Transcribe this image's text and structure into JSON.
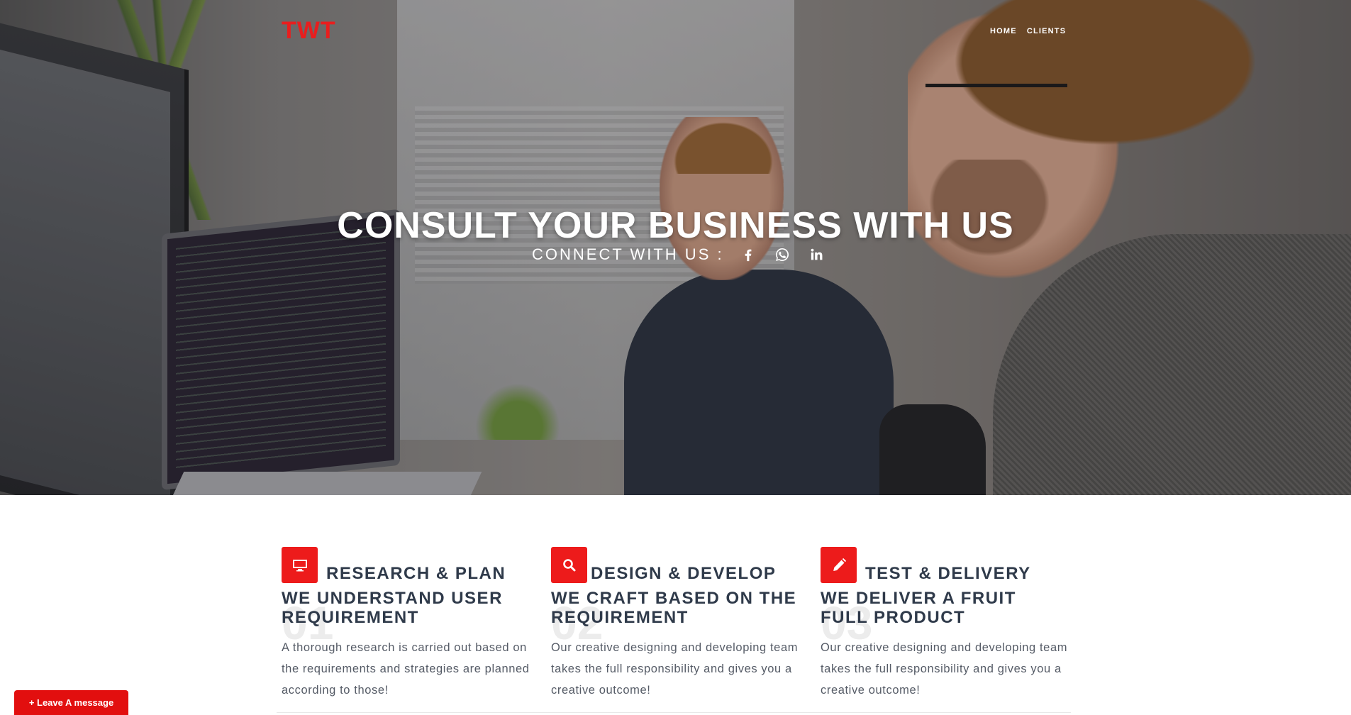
{
  "header": {
    "logo": "TWT",
    "nav": [
      {
        "label": "HOME"
      },
      {
        "label": "CLIENTS"
      }
    ]
  },
  "hero": {
    "title": "CONSULT YOUR BUSINESS WITH US",
    "connect_label": "CONNECT WITH US :",
    "social_icons": [
      "facebook-icon",
      "whatsapp-icon",
      "linkedin-icon"
    ]
  },
  "features": [
    {
      "icon": "desktop-icon",
      "number": "01",
      "title": "RESEARCH & PLAN",
      "subtitle": "WE UNDERSTAND USER REQUIREMENT",
      "description": "A thorough research is carried out based on the requirements and strategies are planned according to those!"
    },
    {
      "icon": "search-icon",
      "number": "02",
      "title": "DESIGN & DEVELOP",
      "subtitle": "WE CRAFT BASED ON THE REQUIREMENT",
      "description": "Our creative designing and developing team takes the full responsibility and gives you a creative outcome!"
    },
    {
      "icon": "pencil-icon",
      "number": "03",
      "title": "TEST & DELIVERY",
      "subtitle": "WE DELIVER A FRUIT FULL PRODUCT",
      "description": "Our creative designing and developing team takes the full responsibility and gives you a creative outcome!"
    }
  ],
  "chat": {
    "leave_message": "+ Leave A message"
  },
  "colors": {
    "accent": "#ed1b1b",
    "heading": "#2f3a4a",
    "body_text": "#555b66"
  }
}
